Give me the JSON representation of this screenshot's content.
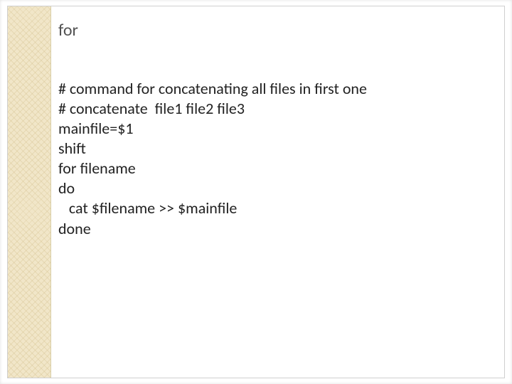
{
  "slide": {
    "title": "for",
    "code_lines": [
      "# command for concatenating all files in first one",
      "# concatenate  file1 file2 file3",
      "mainfile=$1",
      "shift",
      "for filename",
      "do",
      "   cat $filename >> $mainfile",
      "done"
    ]
  }
}
